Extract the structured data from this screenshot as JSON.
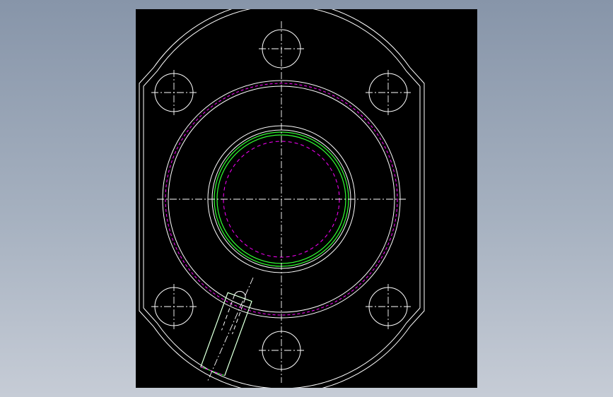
{
  "viewport": {
    "background_top": "#8795a9",
    "background_bottom": "#c6ccd6",
    "sheet_color": "#000000"
  },
  "drawing": {
    "line_colors": {
      "outline": "#ffffff",
      "centerline": "#ffffff",
      "hidden": "#ff00ff",
      "thread": "#33ff33"
    },
    "mounting_hole_count": 6
  }
}
